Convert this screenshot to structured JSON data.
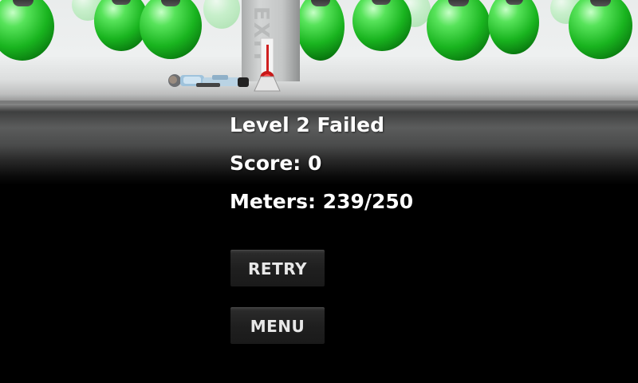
{
  "scene": {
    "pillar_text": "EXIT",
    "bulb_color": "#19b41f"
  },
  "overlay": {
    "level_status": "Level 2 Failed",
    "score_label": "Score:",
    "score_value": "0",
    "meters_label": "Meters:",
    "meters_value": "239/250",
    "meters_progress": 0.956
  },
  "buttons": {
    "retry_label": "RETRY",
    "menu_label": "MENU"
  }
}
